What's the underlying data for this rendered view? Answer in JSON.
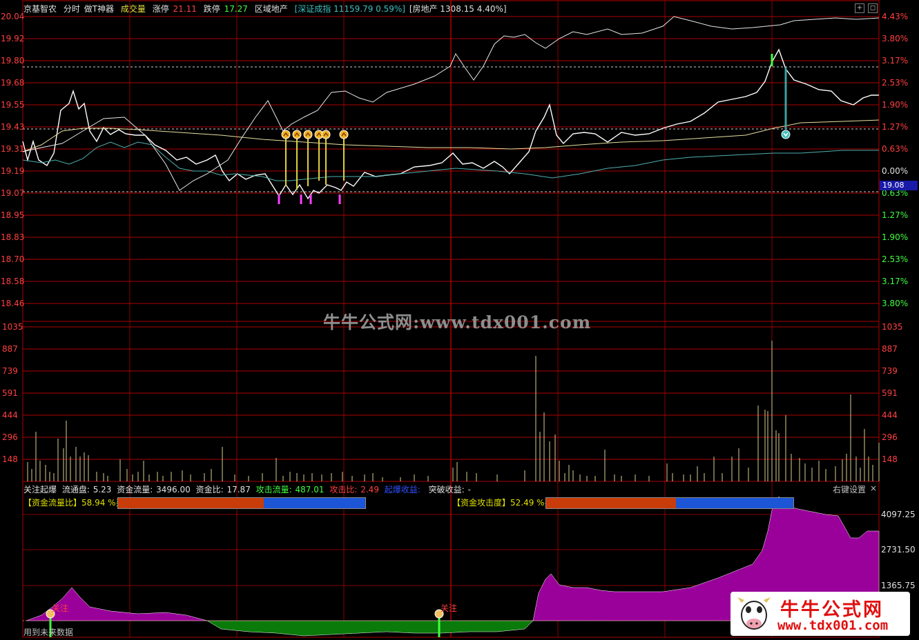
{
  "header": {
    "stock": "京基智农",
    "chart_mode": "分时",
    "tool": "做T神器",
    "volume_label": "成交量",
    "limit_up_label": "涨停",
    "limit_up": "21.11",
    "limit_down_label": "跌停",
    "limit_down": "17.27",
    "sector_label": "区域地产",
    "index_quote": "[深证成指 11159.79 0.59%]",
    "sector_quote": "[房地产 1308.15 4.40%]"
  },
  "price_axis": [
    "20.04",
    "19.92",
    "19.80",
    "19.68",
    "19.55",
    "19.43",
    "19.31",
    "19.19",
    "19.07",
    "18.95",
    "18.83",
    "18.70",
    "18.58",
    "18.46"
  ],
  "pct_axis": [
    {
      "t": "4.43%",
      "c": "red"
    },
    {
      "t": "3.80%",
      "c": "red"
    },
    {
      "t": "3.17%",
      "c": "red"
    },
    {
      "t": "2.53%",
      "c": "red"
    },
    {
      "t": "1.90%",
      "c": "red"
    },
    {
      "t": "1.27%",
      "c": "red"
    },
    {
      "t": "0.63%",
      "c": "red"
    },
    {
      "t": "0.00%",
      "c": "white"
    },
    {
      "t": "0.63%",
      "c": "green"
    },
    {
      "t": "1.27%",
      "c": "green"
    },
    {
      "t": "1.90%",
      "c": "green"
    },
    {
      "t": "2.53%",
      "c": "green"
    },
    {
      "t": "3.17%",
      "c": "green"
    },
    {
      "t": "3.80%",
      "c": "green"
    }
  ],
  "current_price": "19.08",
  "volume_axis": [
    "1035",
    "887",
    "739",
    "591",
    "444",
    "296",
    "148"
  ],
  "indicator": {
    "name": "关注起爆",
    "float_label": "流通盘:",
    "float_value": "5.23",
    "fund_flow_label": "资金流量:",
    "fund_flow_value": "3496.00",
    "fund_ratio_label": "资金比:",
    "fund_ratio_value": "17.87",
    "attack_flow_label": "攻击流量:",
    "attack_flow_value": "487.01",
    "attack_ratio_label": "攻击比:",
    "attack_ratio_value": "2.49",
    "burst_label": "起爆收益:",
    "break_label": "突破收益:",
    "break_value": "-",
    "settings": "右键设置",
    "close": "×",
    "ratio1_label": "【资金流量比】",
    "ratio1_value": "58.94 %买",
    "ratio1_buy": 58.94,
    "ratio2_label": "【资金攻击度】",
    "ratio2_value": "52.49 %买",
    "ratio2_buy": 52.49,
    "marker_label": "关注",
    "axis": [
      "4097.25",
      "2731.50",
      "1365.75"
    ],
    "footer": "用到未来数据"
  },
  "watermark": "牛牛公式网:www.tdx001.com",
  "logo": {
    "title": "牛牛公式网",
    "url": "www.tdx001.com"
  },
  "colors": {
    "grid": "#b00000",
    "up": "#ff4040",
    "down": "#40ff40",
    "price": "#ffffff",
    "avg": "#e8e0a0",
    "index": "#50b0b0",
    "volume": "#d8d090",
    "flow_pos": "#9a009a",
    "flow_neg": "#0a7a0a"
  }
}
